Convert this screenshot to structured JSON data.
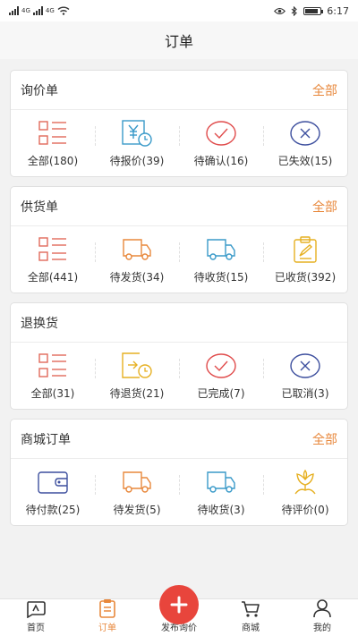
{
  "status_bar": {
    "network_1": "4G",
    "network_2": "4G",
    "time": "6:17"
  },
  "header": {
    "title": "订单"
  },
  "sections": [
    {
      "title": "询价单",
      "all_label": "全部",
      "items": [
        {
          "label": "全部(180)",
          "icon": "list-icon",
          "color": "#e26a5a"
        },
        {
          "label": "待报价(39)",
          "icon": "yen-clock-icon",
          "color": "#3a9ac9"
        },
        {
          "label": "待确认(16)",
          "icon": "check-circle-icon",
          "color": "#e04b4b"
        },
        {
          "label": "已失效(15)",
          "icon": "x-circle-icon",
          "color": "#3d4f9e"
        }
      ]
    },
    {
      "title": "供货单",
      "all_label": "全部",
      "items": [
        {
          "label": "全部(441)",
          "icon": "list-icon",
          "color": "#e26a5a"
        },
        {
          "label": "待发货(34)",
          "icon": "truck-icon",
          "color": "#e8883c"
        },
        {
          "label": "待收货(15)",
          "icon": "truck-icon",
          "color": "#3a9ac9"
        },
        {
          "label": "已收货(392)",
          "icon": "clipboard-icon",
          "color": "#e6b022"
        }
      ]
    },
    {
      "title": "退换货",
      "all_label": "",
      "items": [
        {
          "label": "全部(31)",
          "icon": "list-icon",
          "color": "#e26a5a"
        },
        {
          "label": "待退货(21)",
          "icon": "return-clock-icon",
          "color": "#e6b022"
        },
        {
          "label": "已完成(7)",
          "icon": "check-circle-icon",
          "color": "#e04b4b"
        },
        {
          "label": "已取消(3)",
          "icon": "x-circle-icon",
          "color": "#3d4f9e"
        }
      ]
    },
    {
      "title": "商城订单",
      "all_label": "全部",
      "items": [
        {
          "label": "待付款(25)",
          "icon": "wallet-icon",
          "color": "#3d4f9e"
        },
        {
          "label": "待发货(5)",
          "icon": "truck-icon",
          "color": "#e8883c"
        },
        {
          "label": "待收货(3)",
          "icon": "truck-icon",
          "color": "#3a9ac9"
        },
        {
          "label": "待评价(0)",
          "icon": "flower-icon",
          "color": "#e6b022"
        }
      ]
    }
  ],
  "tabbar": [
    {
      "label": "首页",
      "icon": "home-icon",
      "active": false
    },
    {
      "label": "订单",
      "icon": "order-icon",
      "active": true
    },
    {
      "label": "发布询价",
      "icon": "plus-icon",
      "active": false
    },
    {
      "label": "商城",
      "icon": "cart-icon",
      "active": false
    },
    {
      "label": "我的",
      "icon": "user-icon",
      "active": false
    }
  ],
  "colors": {
    "accent": "#e8883c",
    "fab": "#e8453c"
  }
}
